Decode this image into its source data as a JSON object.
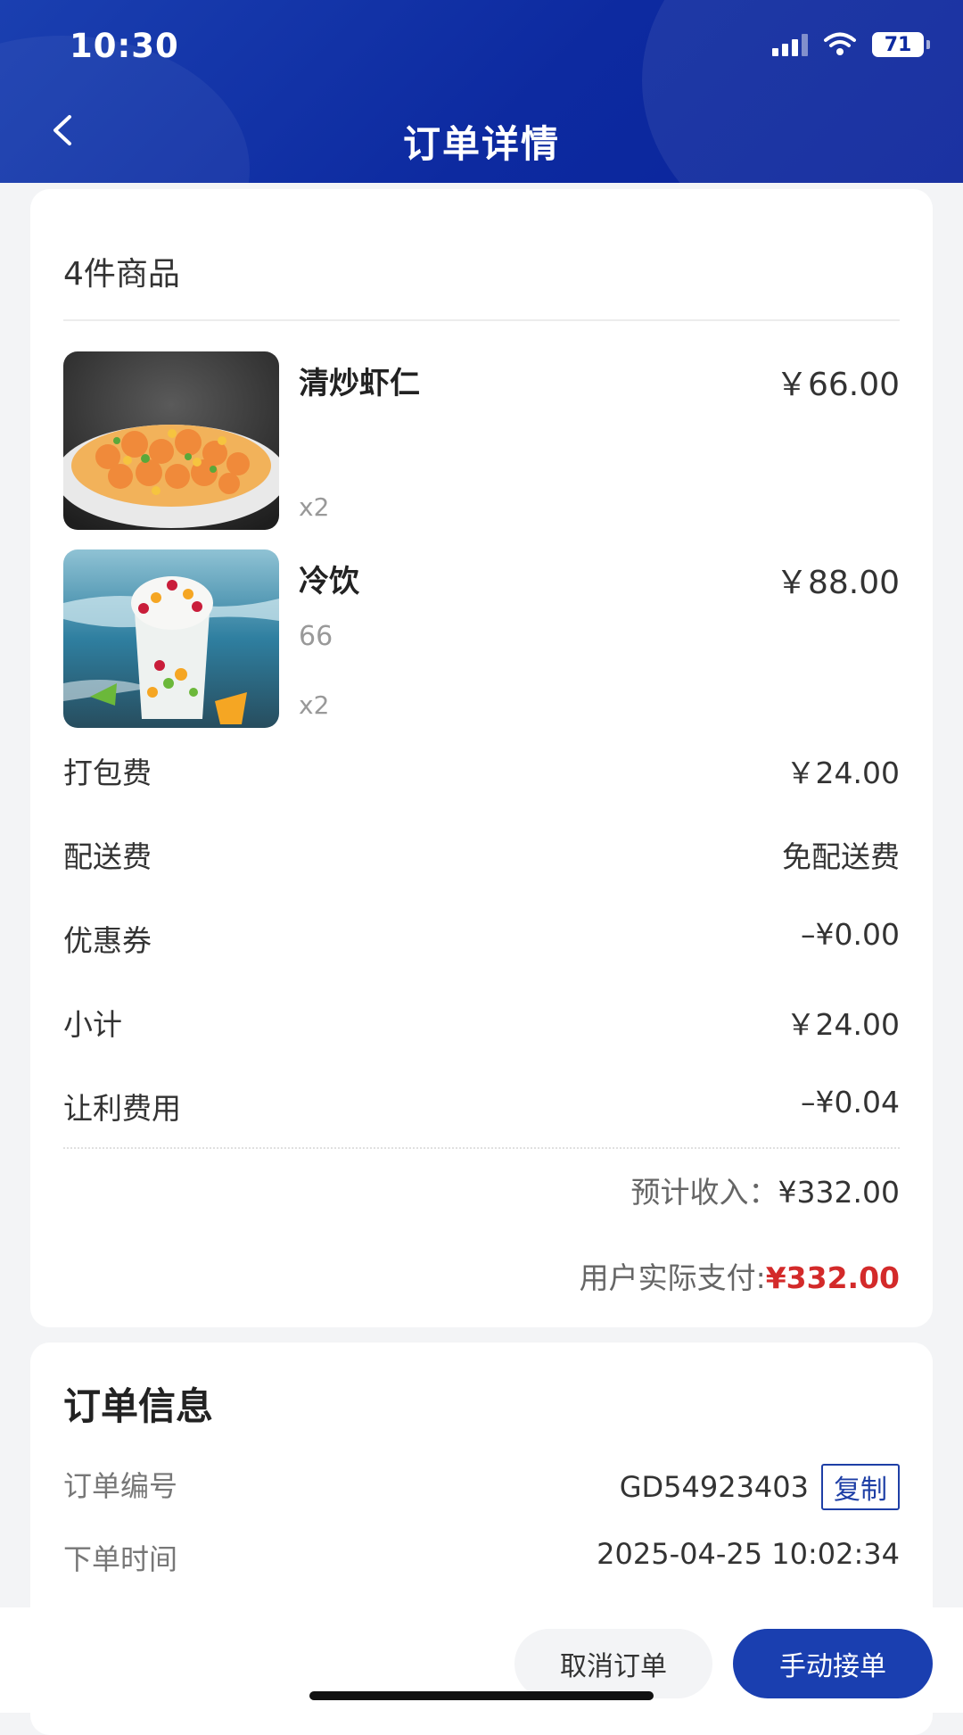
{
  "status_bar": {
    "time": "10:30",
    "battery": "71"
  },
  "header": {
    "title": "订单详情"
  },
  "goods": {
    "count_label": "4件商品",
    "items": [
      {
        "name": "清炒虾仁",
        "price": "￥66.00",
        "spec": "",
        "qty": "x2"
      },
      {
        "name": "冷饮",
        "price": "￥88.00",
        "spec": "66",
        "qty": "x2"
      }
    ]
  },
  "fees": [
    {
      "label": "打包费",
      "value": "￥24.00"
    },
    {
      "label": "配送费",
      "value": "免配送费"
    },
    {
      "label": "优惠券",
      "value": "–¥0.00"
    },
    {
      "label": "小计",
      "value": "￥24.00"
    },
    {
      "label": "让利费用",
      "value": "–¥0.04"
    }
  ],
  "summary": {
    "expected_label": "预计收入：",
    "expected_value": "¥332.00",
    "paid_label": "用户实际支付:",
    "paid_value": "¥332.00"
  },
  "order_info": {
    "title": "订单信息",
    "number_label": "订单编号",
    "number_value": "GD54923403",
    "copy_label": "复制",
    "time_label": "下单时间",
    "time_value": "2025-04-25 10:02:34"
  },
  "actions": {
    "cancel": "取消订单",
    "accept": "手动接单"
  },
  "colors": {
    "primary": "#1a3fb0",
    "price_red": "#d32a2a"
  }
}
